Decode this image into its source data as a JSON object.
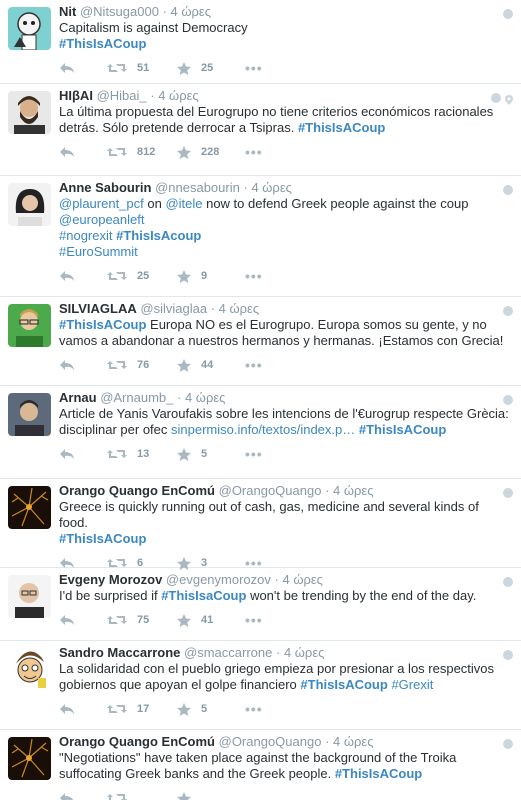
{
  "colors": {
    "link": "#3b88c3",
    "muted": "#8899a6",
    "icon": "#aab8c2",
    "border": "#e1e8ed"
  },
  "icons": {
    "reply": "reply-icon",
    "retweet": "retweet-icon",
    "favorite": "star-icon",
    "more": "more-icon",
    "globe": "globe-icon",
    "location": "location-pin-icon"
  },
  "tweets": [
    {
      "name": "Nit",
      "handle": "@Nitsuga000",
      "time": "4 ώρες",
      "dot": "·",
      "text": [
        {
          "t": "Capitalism is against Democracy"
        },
        {
          "br": true
        },
        {
          "t": "#ThisIsACoup",
          "k": "tag"
        }
      ],
      "retweets": "51",
      "favorites": "25",
      "more": "•••",
      "avatar": "cartoon"
    },
    {
      "name": "HIβAI",
      "handle": "@Hibai_",
      "time": "4 ώρες",
      "dot": "·",
      "text": [
        {
          "t": "La última propuesta del Eurogrupo no tiene criterios económicos racionales detrás. Sólo pretende derrocar a Tsipras.  "
        },
        {
          "t": "#ThisIsACoup",
          "k": "tag"
        }
      ],
      "retweets": "812",
      "favorites": "228",
      "more": "•••",
      "avatar": "beard",
      "location": true
    },
    {
      "name": "Anne Sabourin",
      "handle": "@nnesabourin",
      "time": "4 ώρες",
      "dot": "·",
      "text": [
        {
          "t": "@plaurent_pcf",
          "k": "link"
        },
        {
          "t": " on "
        },
        {
          "t": "@itele",
          "k": "link"
        },
        {
          "t": " now to defend Greek people against the coup "
        },
        {
          "t": "@europeanleft",
          "k": "link"
        },
        {
          "br": true
        },
        {
          "t": "#nogrexit",
          "k": "link"
        },
        {
          "t": " "
        },
        {
          "t": "#ThisIsAcoup",
          "k": "tag"
        },
        {
          "br": true
        },
        {
          "t": "#EuroSummit",
          "k": "link"
        }
      ],
      "retweets": "25",
      "favorites": "9",
      "more": "•••",
      "avatar": "woman"
    },
    {
      "name": "SILVIAGLAA",
      "handle": "@silviaglaa",
      "time": "4 ώρες",
      "dot": "·",
      "text": [
        {
          "t": "#ThisIsACoup",
          "k": "tag"
        },
        {
          "t": " Europa NO es el Eurogrupo. Europa somos su gente, y no vamos a abandonar a nuestros hermanos y hermanas. ¡Estamos con Grecia!"
        }
      ],
      "retweets": "76",
      "favorites": "44",
      "more": "•••",
      "avatar": "green"
    },
    {
      "name": "Arnau",
      "handle": "@Arnaumb_",
      "time": "4 ώρες",
      "dot": "·",
      "text": [
        {
          "t": "Article de Yanis Varoufakis sobre les intencions de l'€urogrup respecte Grècia: disciplinar per ofec "
        },
        {
          "t": "sinpermiso.info/textos/index.p…",
          "k": "link"
        },
        {
          "t": " "
        },
        {
          "t": "#ThisIsACoup",
          "k": "tag"
        }
      ],
      "retweets": "13",
      "favorites": "5",
      "more": "•••",
      "avatar": "man"
    },
    {
      "name": "Orango Quango EnComú",
      "handle": "@OrangoQuango",
      "time": "4 ώρες",
      "dot": "·",
      "text": [
        {
          "t": "Greece is quickly running out of cash, gas, medicine and several kinds of food."
        },
        {
          "br": true
        },
        {
          "t": "#ThisIsACoup",
          "k": "tag"
        }
      ],
      "retweets": "6",
      "favorites": "3",
      "more": "•••",
      "avatar": "neuron"
    },
    {
      "name": "Evgeny Morozov",
      "handle": "@evgenymorozov",
      "time": "4 ώρες",
      "dot": "·",
      "text": [
        {
          "t": "I'd be surprised if "
        },
        {
          "t": "#ThisIsaCoup",
          "k": "tag"
        },
        {
          "t": " won't be trending by the end of the day."
        }
      ],
      "retweets": "75",
      "favorites": "41",
      "more": "•••",
      "avatar": "bald"
    },
    {
      "name": "Sandro Maccarrone",
      "handle": "@smaccarrone",
      "time": "4 ώρες",
      "dot": "·",
      "text": [
        {
          "t": "La solidaridad con el pueblo griego empieza por presionar a los respectivos gobiernos que apoyan el golpe financiero "
        },
        {
          "t": "#ThisIsACoup",
          "k": "tag"
        },
        {
          "t": " "
        },
        {
          "t": "#Grexit",
          "k": "link"
        }
      ],
      "retweets": "17",
      "favorites": "5",
      "more": "•••",
      "avatar": "caricature"
    },
    {
      "name": "Orango Quango EnComú",
      "handle": "@OrangoQuango",
      "time": "4 ώρες",
      "dot": "·",
      "text": [
        {
          "t": "\"Negotiations\" have  taken place against the background of the Troika suffocating Greek  banks and the Greek people. "
        },
        {
          "t": "#ThisIsACoup",
          "k": "tag"
        }
      ],
      "retweets": "",
      "favorites": "",
      "more": "",
      "avatar": "neuron"
    }
  ]
}
